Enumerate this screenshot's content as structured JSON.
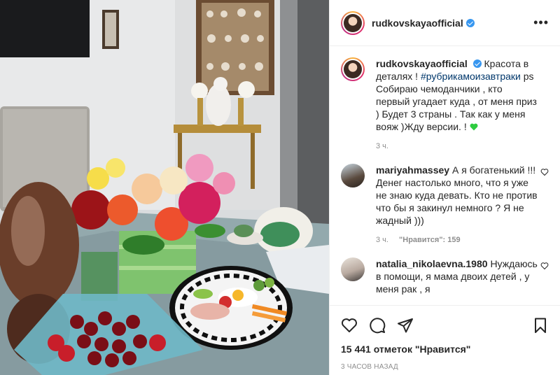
{
  "post": {
    "username": "rudkovskayaofficial",
    "verified": true
  },
  "caption": {
    "username": "rudkovskayaofficial",
    "text_before": "Красота в деталях !",
    "hashtag": "#рубрикамоизавтраки",
    "text_after": "ps Собираю чемоданчики , кто первый угадает куда , от меня приз ) Будет 3 страны . Так как у меня вояж )Жду версии. !",
    "emoji": "green-heart",
    "time": "3 ч."
  },
  "comments": [
    {
      "username": "mariyahmassey",
      "text": "А я богатенький !!! Денег настолько много, что я уже не знаю куда девать. Кто не против что бы я закинул немного ? Я не жадный )))",
      "time": "3 ч.",
      "likes": "\"Нравится\": 159"
    },
    {
      "username": "natalia_nikolaevna.1980",
      "text": "Нуждаюсь в помощи, я мама двоих детей , у меня рак , я"
    }
  ],
  "actions": {
    "like_icon": "heart-icon",
    "comment_icon": "comment-icon",
    "share_icon": "share-icon",
    "save_icon": "bookmark-icon",
    "likes_text": "15 441 отметок \"Нравится\"",
    "time_ago": "3 ЧАСОВ НАЗАД"
  },
  "colors": {
    "link": "#00376b",
    "verified": "#3897f0",
    "muted": "#8e8e8e",
    "emoji_heart": "#2ecc40"
  }
}
